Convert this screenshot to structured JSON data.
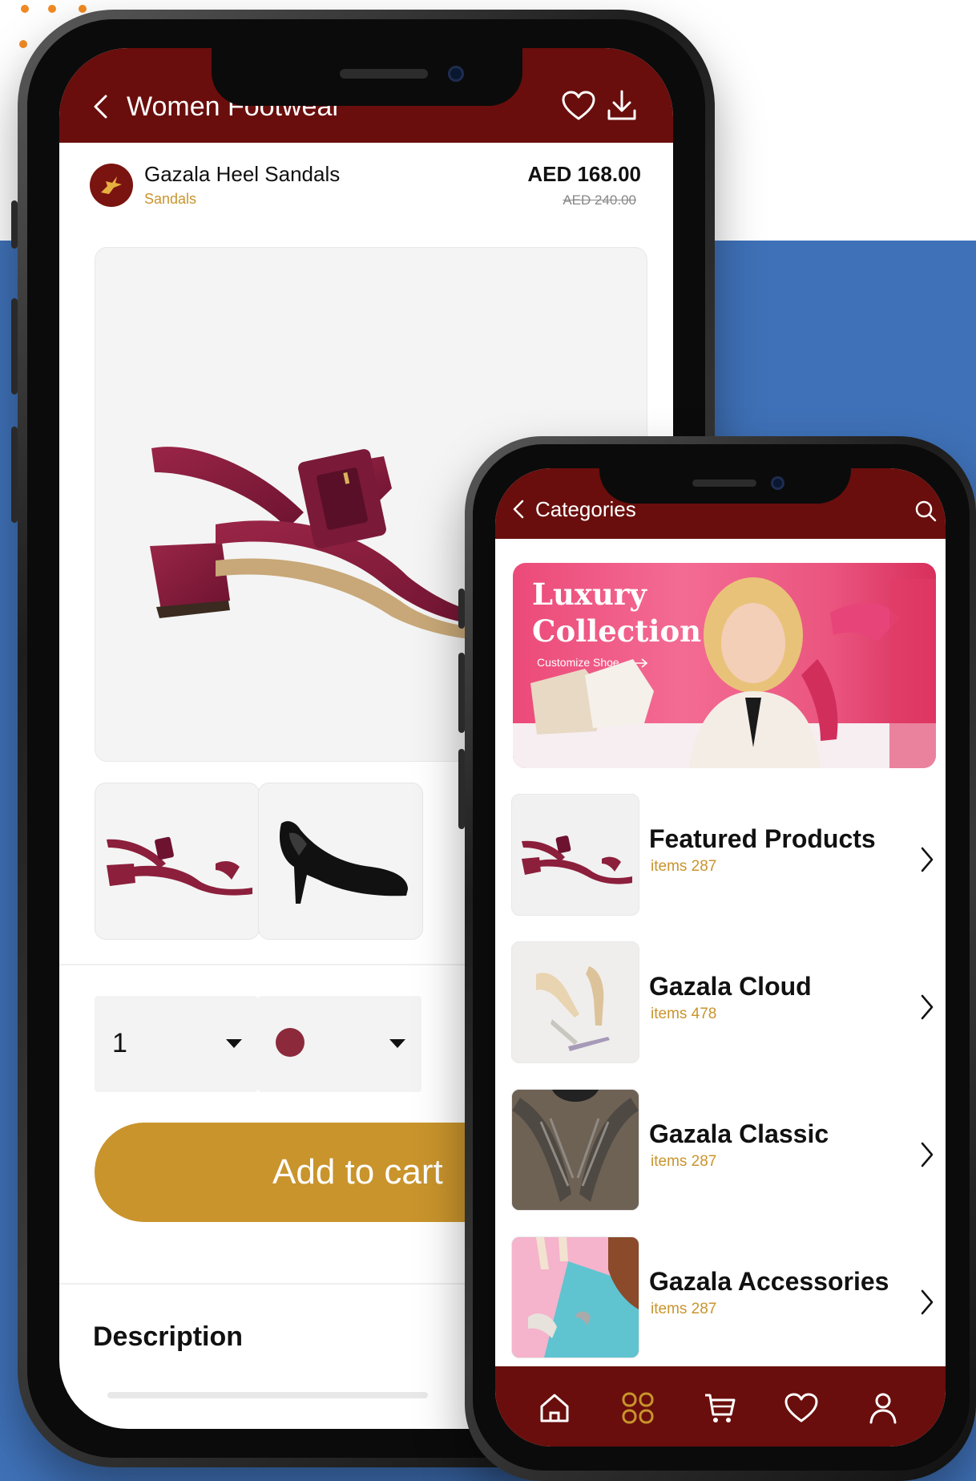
{
  "colors": {
    "primary": "#690e0c",
    "accent": "#c9942c",
    "background_blue": "#3f71b8",
    "price_old": "#888888"
  },
  "product_screen": {
    "header": {
      "title": "Women Footwear",
      "back_icon": "chevron-left-icon",
      "favorite_icon": "heart-icon",
      "download_icon": "download-icon"
    },
    "product": {
      "name": "Gazala Heel Sandals",
      "category": "Sandals",
      "price": "AED  168.00",
      "old_price": "AED  240.00",
      "brand_icon": "gazelle-logo-icon"
    },
    "thumbnails": [
      "burgundy-sandal-thumb",
      "black-pump-thumb"
    ],
    "quantity": "1",
    "selected_color": "#8c2a3c",
    "add_to_cart_label": "Add to cart",
    "description_title": "Description"
  },
  "categories_screen": {
    "header": {
      "title": "Categories",
      "back_icon": "chevron-left-icon",
      "search_icon": "search-icon"
    },
    "banner": {
      "title_line1": "Luxury",
      "title_line2": "Collection",
      "cta": "Customize Shoe"
    },
    "categories": [
      {
        "name": "Featured Products",
        "count": "items 287"
      },
      {
        "name": "Gazala Cloud",
        "count": "items 478"
      },
      {
        "name": "Gazala Classic",
        "count": "items 287"
      },
      {
        "name": "Gazala Accessories",
        "count": "items 287"
      }
    ],
    "tabs": [
      "home-icon",
      "grid-icon",
      "cart-icon",
      "heart-icon",
      "user-icon"
    ]
  }
}
